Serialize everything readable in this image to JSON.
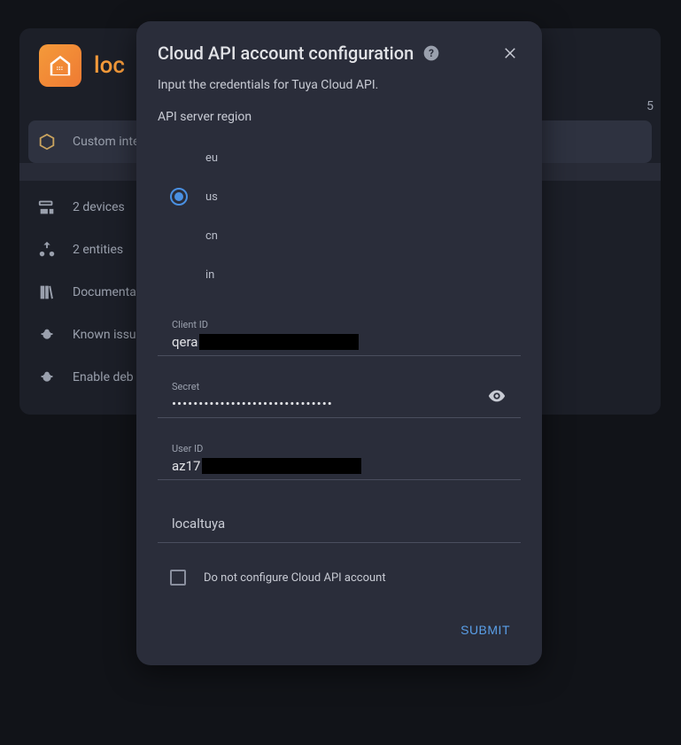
{
  "panel": {
    "title": "loc",
    "subtitle_visible": "5",
    "menu": [
      {
        "label": "Custom inte",
        "icon": "cube"
      },
      {
        "label": "2 devices",
        "icon": "devices"
      },
      {
        "label": "2 entities",
        "icon": "entities"
      },
      {
        "label": "Documenta",
        "icon": "docs"
      },
      {
        "label": "Known issu",
        "icon": "bug"
      },
      {
        "label": "Enable deb",
        "icon": "bug"
      }
    ]
  },
  "dialog": {
    "title": "Cloud API account configuration",
    "description": "Input the credentials for Tuya Cloud API.",
    "region_label": "API server region",
    "regions": [
      {
        "code": "eu",
        "selected": false
      },
      {
        "code": "us",
        "selected": true
      },
      {
        "code": "cn",
        "selected": false
      },
      {
        "code": "in",
        "selected": false
      }
    ],
    "fields": {
      "client_id": {
        "label": "Client ID",
        "value": "qera"
      },
      "secret": {
        "label": "Secret",
        "value": "••••••••••••••••••••••••••••••"
      },
      "user_id": {
        "label": "User ID",
        "value": "az17"
      },
      "plain": "localtuya"
    },
    "checkbox_label": "Do not configure Cloud API account",
    "checkbox_checked": false,
    "submit": "SUBMIT"
  }
}
